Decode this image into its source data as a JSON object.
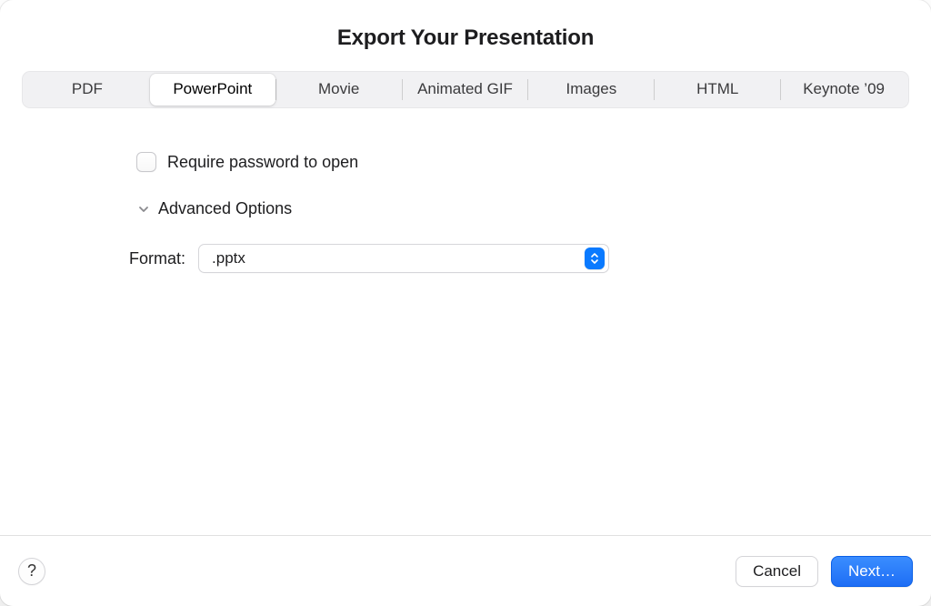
{
  "title": "Export Your Presentation",
  "tabs": {
    "items": [
      {
        "label": "PDF",
        "selected": false
      },
      {
        "label": "PowerPoint",
        "selected": true
      },
      {
        "label": "Movie",
        "selected": false
      },
      {
        "label": "Animated GIF",
        "selected": false
      },
      {
        "label": "Images",
        "selected": false
      },
      {
        "label": "HTML",
        "selected": false
      },
      {
        "label": "Keynote ’09",
        "selected": false
      }
    ]
  },
  "options": {
    "require_password_label": "Require password to open",
    "require_password_checked": false,
    "advanced_label": "Advanced Options",
    "advanced_expanded": true
  },
  "format": {
    "label": "Format:",
    "value": ".pptx"
  },
  "footer": {
    "help_label": "?",
    "cancel_label": "Cancel",
    "next_label": "Next…"
  }
}
